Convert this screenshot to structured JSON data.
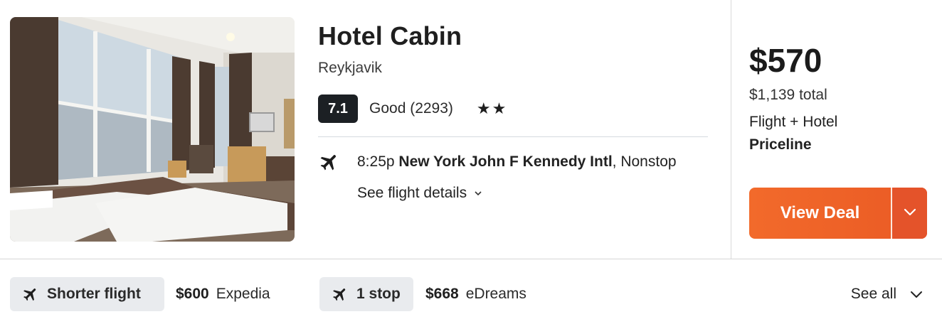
{
  "hotel": {
    "name": "Hotel Cabin",
    "city": "Reykjavik",
    "score": "7.1",
    "rating_label": "Good (2293)",
    "stars": "★★"
  },
  "flight": {
    "time": "8:25p",
    "airport": "New York John F Kennedy Intl",
    "stops": ", Nonstop",
    "details_label": "See flight details"
  },
  "pricing": {
    "price": "$570",
    "total": "$1,139 total",
    "package": "Flight + Hotel",
    "provider": "Priceline",
    "deal_button": "View Deal"
  },
  "alternatives": [
    {
      "chip_label": "Shorter flight",
      "price": "$600",
      "provider": "Expedia"
    },
    {
      "chip_label": "1 stop",
      "price": "$668",
      "provider": "eDreams"
    }
  ],
  "see_all_label": "See all",
  "icons": {
    "plane": "airplane-icon",
    "chevron": "chevron-down-icon"
  },
  "colors": {
    "accent": "#ec6029",
    "score_badge": "#1c2024",
    "chip_bg": "#e9ebee"
  }
}
